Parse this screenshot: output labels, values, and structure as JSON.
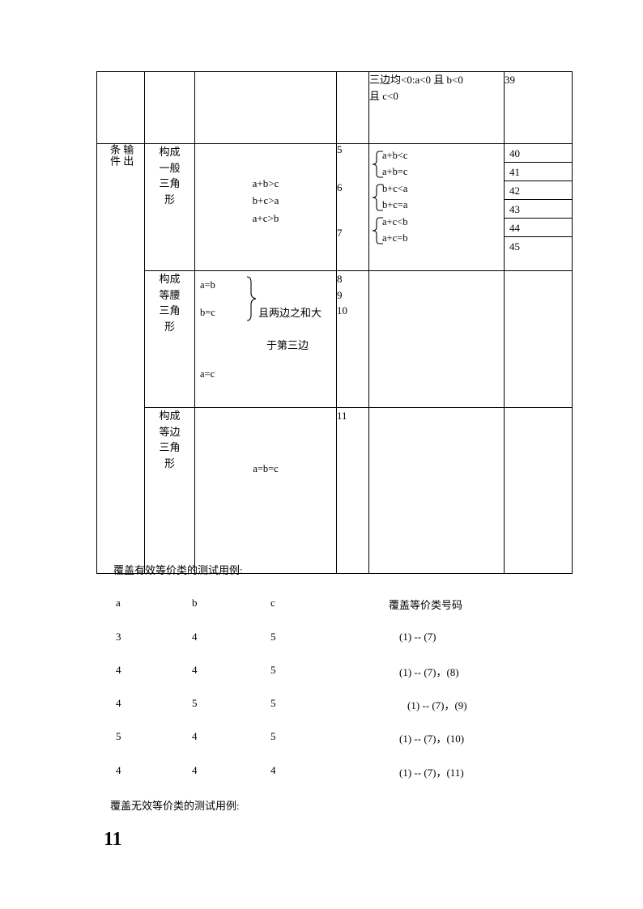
{
  "document": {
    "page_number": "11"
  },
  "table": {
    "row_neg": {
      "condition_line1": "三边均<0:a<0 且 b<0",
      "condition_line2": "且 c<0",
      "id": "39"
    },
    "output_condition_label_col1": "输出",
    "output_condition_label_col2": "条件",
    "general": {
      "kind": [
        "构成",
        "一般",
        "三角",
        "形"
      ],
      "conditions": [
        "a+b>c",
        "b+c>a",
        "a+c>b"
      ],
      "numbers": [
        "5",
        "6",
        "7"
      ],
      "sub_conditions": [
        "a+b<c",
        "a+b=c",
        "b+c<a",
        "b+c=a",
        "a+c<b",
        "a+c=b"
      ],
      "ids": [
        "40",
        "41",
        "42",
        "43",
        "44",
        "45"
      ]
    },
    "isosceles": {
      "kind": [
        "构成",
        "等腰",
        "三角",
        "形"
      ],
      "labels": [
        "a=b",
        "b=c",
        "a=c"
      ],
      "note_line1": "且两边之和大",
      "note_line2": "于第三边",
      "numbers": [
        "8",
        "9",
        "10"
      ],
      "sub_conditions": "",
      "ids": ""
    },
    "equilateral": {
      "kind": [
        "构成",
        "等边",
        "三角",
        "形"
      ],
      "condition": "a=b=c",
      "numbers": [
        "11"
      ],
      "sub_conditions": "",
      "ids": ""
    }
  },
  "valid_cases": {
    "heading": "覆盖有效等价类的测试用例:",
    "columns": [
      "a",
      "b",
      "c",
      "覆盖等价类号码"
    ],
    "rows": [
      {
        "a": "3",
        "b": "4",
        "c": "5",
        "classes": "(1) -- (7)",
        "indent": 493
      },
      {
        "a": "4",
        "b": "4",
        "c": "5",
        "classes": "(1) -- (7)，(8)",
        "indent": 493
      },
      {
        "a": "4",
        "b": "5",
        "c": "5",
        "classes": "(1) -- (7)，(9)",
        "indent": 501
      },
      {
        "a": "5",
        "b": "4",
        "c": "5",
        "classes": "(1) -- (7)，(10)",
        "indent": 493
      },
      {
        "a": "4",
        "b": "4",
        "c": "4",
        "classes": "(1) -- (7)，(11)",
        "indent": 493
      }
    ]
  },
  "invalid_cases": {
    "heading": "覆盖无效等价类的测试用例:"
  }
}
